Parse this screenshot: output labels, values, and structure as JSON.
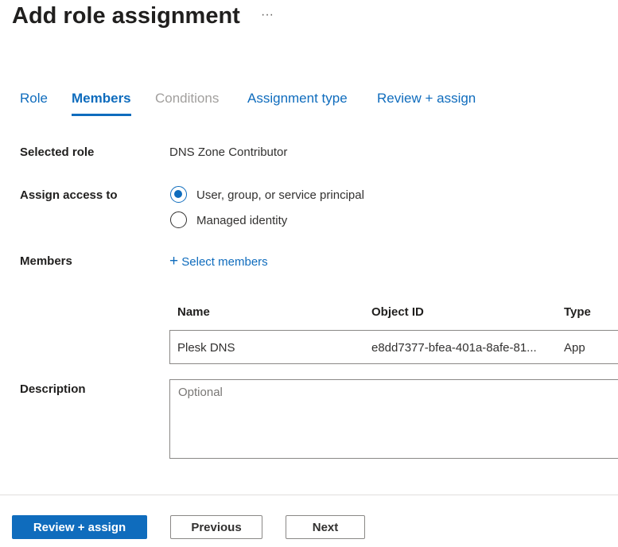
{
  "header": {
    "title": "Add role assignment",
    "more": "···"
  },
  "tabs": [
    {
      "label": "Role"
    },
    {
      "label": "Members"
    },
    {
      "label": "Conditions"
    },
    {
      "label": "Assignment type"
    },
    {
      "label": "Review + assign"
    }
  ],
  "form": {
    "selected_role_label": "Selected role",
    "selected_role_value": "DNS Zone Contributor",
    "assign_access_label": "Assign access to",
    "assign_options": [
      {
        "label": "User, group, or service principal",
        "selected": true
      },
      {
        "label": "Managed identity",
        "selected": false
      }
    ],
    "members_label": "Members",
    "select_members": "Select members",
    "table": {
      "headers": [
        "Name",
        "Object ID",
        "Type"
      ],
      "rows": [
        {
          "name": "Plesk DNS",
          "object_id": "e8dd7377-bfea-401a-8afe-81...",
          "type": "App"
        }
      ]
    },
    "description_label": "Description",
    "description_placeholder": "Optional"
  },
  "footer": {
    "review_assign": "Review + assign",
    "previous": "Previous",
    "next": "Next"
  }
}
